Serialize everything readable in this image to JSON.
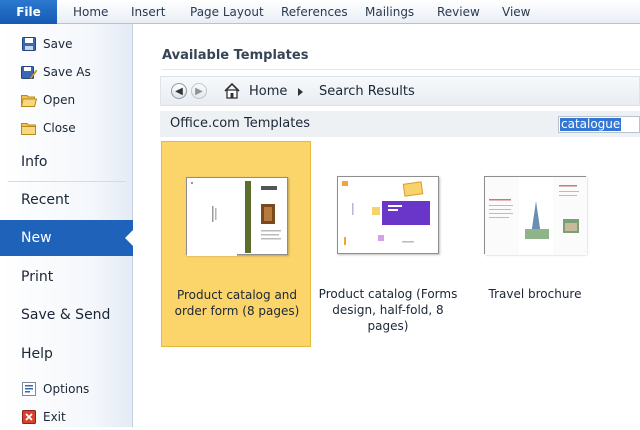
{
  "ribbon": {
    "file": "File",
    "tabs": [
      "Home",
      "Insert",
      "Page Layout",
      "References",
      "Mailings",
      "Review",
      "View"
    ]
  },
  "backstage": {
    "commands": [
      {
        "label": "Save",
        "icon": "save-icon"
      },
      {
        "label": "Save As",
        "icon": "save-as-icon"
      },
      {
        "label": "Open",
        "icon": "open-folder-icon"
      },
      {
        "label": "Close",
        "icon": "close-folder-icon"
      }
    ],
    "nav": [
      "Info",
      "Recent",
      "New",
      "Print",
      "Save & Send",
      "Help"
    ],
    "selected_nav": "New",
    "footer": [
      {
        "label": "Options",
        "icon": "options-icon"
      },
      {
        "label": "Exit",
        "icon": "exit-icon"
      }
    ]
  },
  "main": {
    "title": "Available Templates",
    "breadcrumb": {
      "home": "Home",
      "current": "Search Results"
    },
    "section_label": "Office.com Templates",
    "search_value": "catalogue",
    "templates": [
      {
        "name": "Product catalog and order form (8 pages)",
        "selected": true
      },
      {
        "name": "Product catalog (Forms design, half-fold, 8 pages)",
        "selected": false
      },
      {
        "name": "Travel brochure",
        "selected": false
      }
    ]
  },
  "colors": {
    "accent": "#1e63b9",
    "selection": "#fbd56a",
    "file_tab": "#2b79d0"
  }
}
